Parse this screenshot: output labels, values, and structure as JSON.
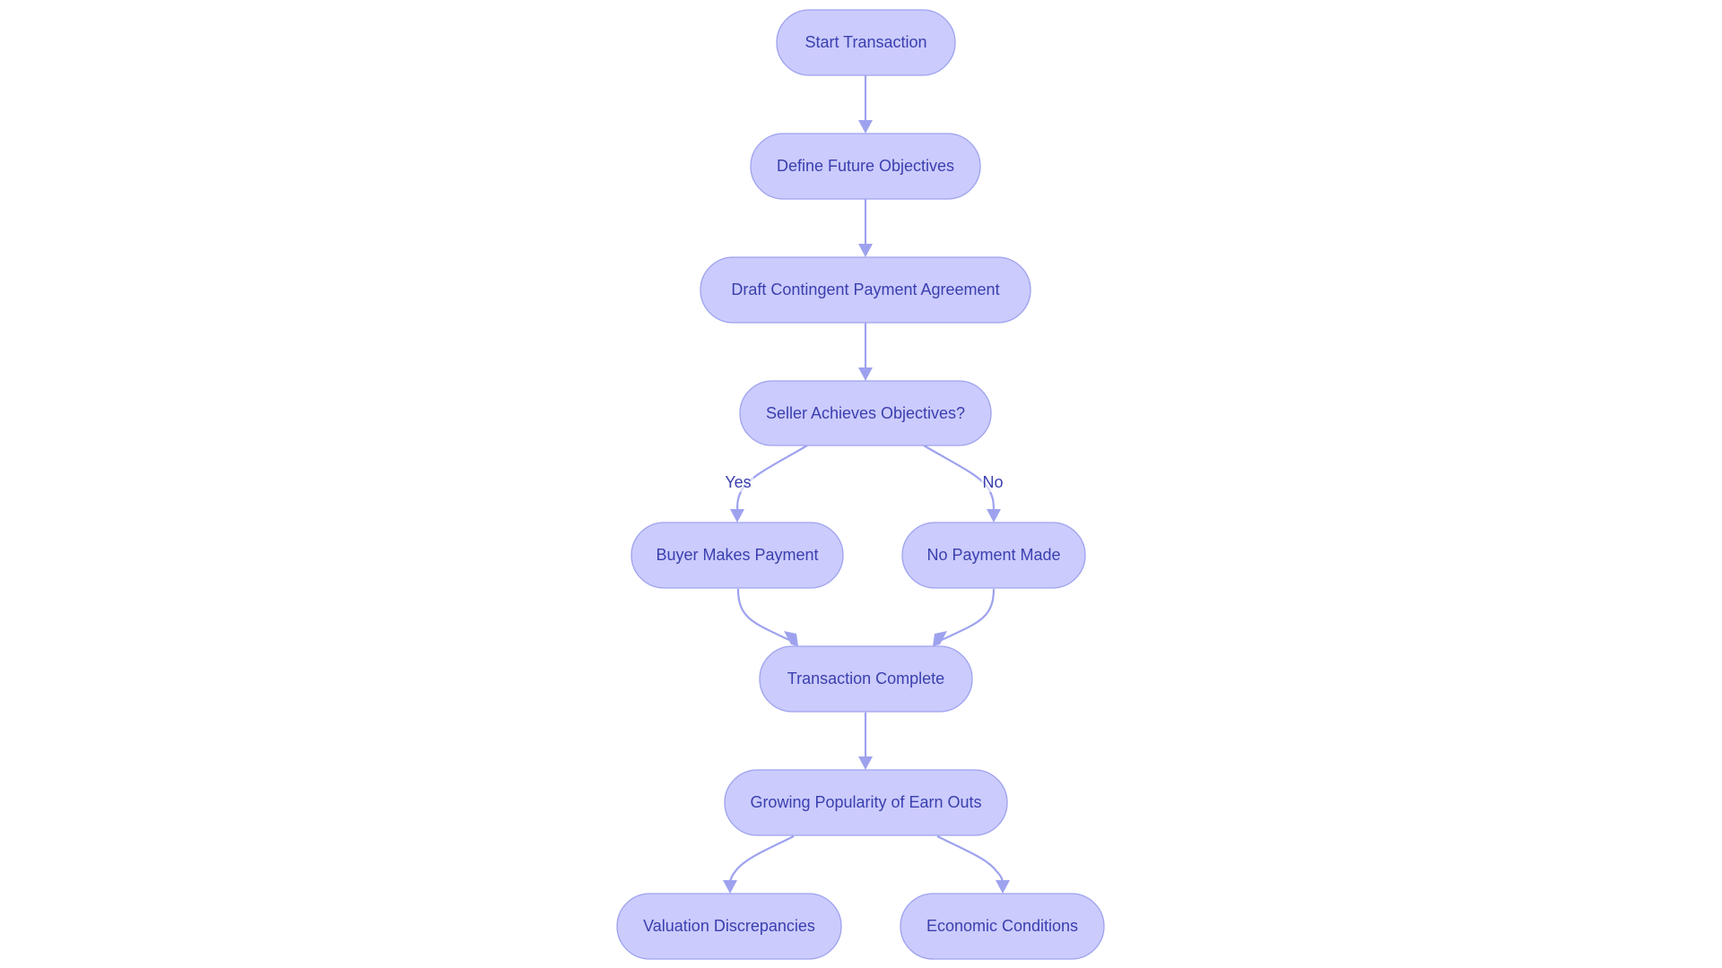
{
  "diagram": {
    "type": "flowchart",
    "direction": "top-down",
    "colors": {
      "node_fill": "#cbcbfd",
      "node_stroke": "#9ea2ee",
      "text": "#3a3fae",
      "edge": "#9ea2ee",
      "background": "#ffffff"
    },
    "nodes": [
      {
        "id": "start",
        "label": "Start Transaction",
        "shape": "stadium"
      },
      {
        "id": "define",
        "label": "Define Future Objectives",
        "shape": "stadium"
      },
      {
        "id": "draft",
        "label": "Draft Contingent Payment Agreement",
        "shape": "stadium"
      },
      {
        "id": "seller",
        "label": "Seller Achieves Objectives?",
        "shape": "stadium"
      },
      {
        "id": "buyer",
        "label": "Buyer Makes Payment",
        "shape": "stadium"
      },
      {
        "id": "nopay",
        "label": "No Payment Made",
        "shape": "stadium"
      },
      {
        "id": "complete",
        "label": "Transaction Complete",
        "shape": "stadium"
      },
      {
        "id": "growing",
        "label": "Growing Popularity of Earn Outs",
        "shape": "stadium"
      },
      {
        "id": "valuation",
        "label": "Valuation Discrepancies",
        "shape": "stadium"
      },
      {
        "id": "economic",
        "label": "Economic Conditions",
        "shape": "stadium"
      }
    ],
    "edges": [
      {
        "from": "start",
        "to": "define",
        "label": ""
      },
      {
        "from": "define",
        "to": "draft",
        "label": ""
      },
      {
        "from": "draft",
        "to": "seller",
        "label": ""
      },
      {
        "from": "seller",
        "to": "buyer",
        "label": "Yes"
      },
      {
        "from": "seller",
        "to": "nopay",
        "label": "No"
      },
      {
        "from": "buyer",
        "to": "complete",
        "label": ""
      },
      {
        "from": "nopay",
        "to": "complete",
        "label": ""
      },
      {
        "from": "complete",
        "to": "growing",
        "label": ""
      },
      {
        "from": "growing",
        "to": "valuation",
        "label": ""
      },
      {
        "from": "growing",
        "to": "economic",
        "label": ""
      }
    ]
  }
}
